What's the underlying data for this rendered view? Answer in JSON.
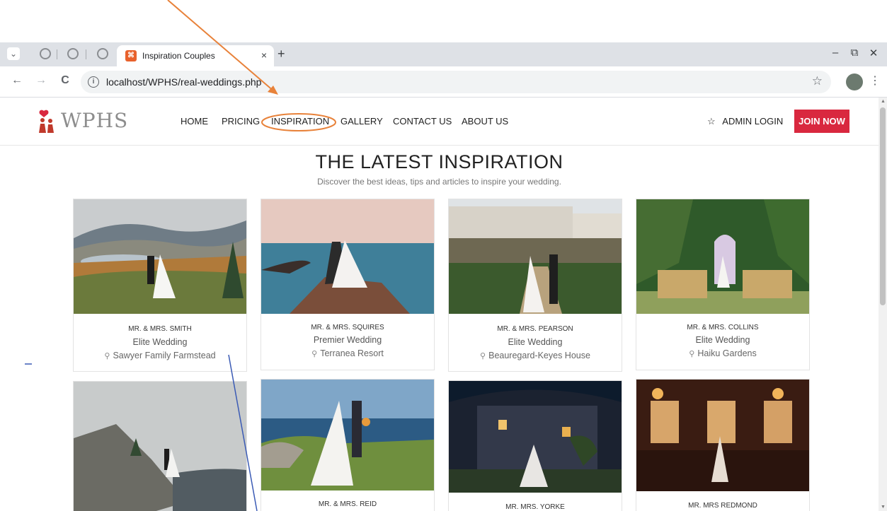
{
  "browser": {
    "tab_title": "Inspiration Couples",
    "tab_favicon": "xampp-icon",
    "tab_close": "×",
    "new_tab": "+",
    "url": "localhost/WPHS/real-weddings.php",
    "window_min": "–",
    "window_restore": "⧉",
    "window_close": "✕",
    "back": "←",
    "forward": "→",
    "reload": "C",
    "bookmark": "☆",
    "menu": "⋮"
  },
  "site": {
    "logo_text": "WPHS",
    "nav": [
      "HOME",
      "PRICING",
      "INSPIRATION",
      "GALLERY",
      "CONTACT US",
      "ABOUT US"
    ],
    "admin_star": "☆",
    "admin_label": "ADMIN LOGIN",
    "join_label": "JOIN NOW",
    "hero_title": "THE LATEST INSPIRATION",
    "hero_subtitle": "Discover the best ideas, tips and articles to inspire your wedding.",
    "pin": "⚲",
    "couples": [
      {
        "name": "MR. & MRS. SMITH",
        "package": "Elite Wedding",
        "location": "Sawyer Family Farmstead"
      },
      {
        "name": "MR. & MRS. SQUIRES",
        "package": "Premier Wedding",
        "location": "Terranea Resort"
      },
      {
        "name": "MR. & MRS. PEARSON",
        "package": "Elite Wedding",
        "location": "Beauregard-Keyes House"
      },
      {
        "name": "MR. & MRS. COLLINS",
        "package": "Elite Wedding",
        "location": "Haiku Gardens"
      },
      {
        "name": "",
        "package": "",
        "location": ""
      },
      {
        "name": "MR. & MRS. REID",
        "package": "",
        "location": ""
      },
      {
        "name": "MR. MRS. YORKE",
        "package": "",
        "location": ""
      },
      {
        "name": "MR. MRS REDMOND",
        "package": "",
        "location": ""
      }
    ]
  },
  "colors": {
    "accent_red": "#d9283f",
    "annotation_orange": "#e8823a",
    "annotation_blue": "#3b5bb5"
  }
}
